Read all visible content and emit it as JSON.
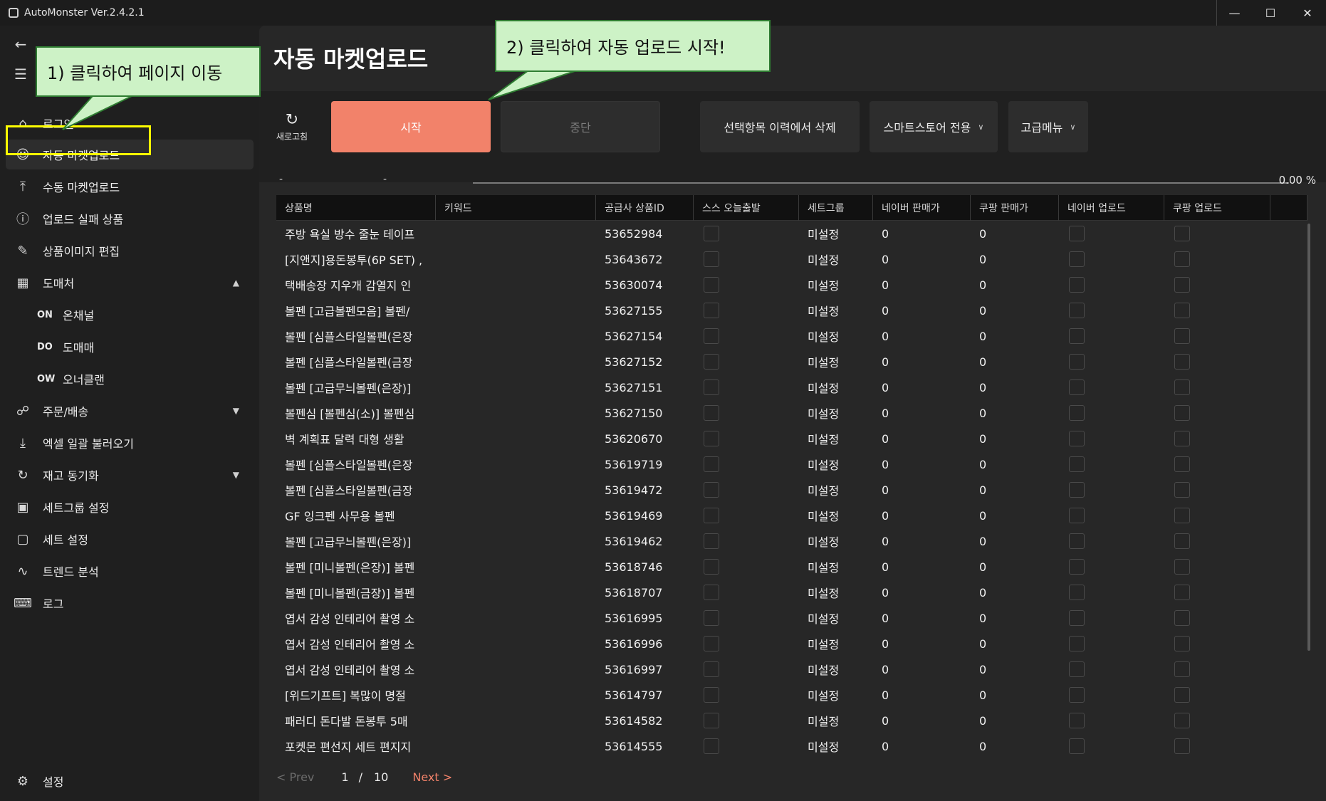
{
  "window": {
    "title": "AutoMonster Ver.2.4.2.1"
  },
  "sidebar": {
    "items": [
      {
        "label": "로그인"
      },
      {
        "label": "자동 마켓업로드"
      },
      {
        "label": "수동 마켓업로드"
      },
      {
        "label": "업로드 실패 상품"
      },
      {
        "label": "상품이미지 편집"
      },
      {
        "label": "도매처"
      },
      {
        "label": "주문/배송"
      },
      {
        "label": "엑셀 일괄 불러오기"
      },
      {
        "label": "재고 동기화"
      },
      {
        "label": "세트그룹 설정"
      },
      {
        "label": "세트 설정"
      },
      {
        "label": "트렌드 분석"
      },
      {
        "label": "로그"
      }
    ],
    "sub_items": [
      {
        "badge": "ON",
        "label": "온채널"
      },
      {
        "badge": "DO",
        "label": "도매매"
      },
      {
        "badge": "OW",
        "label": "오너클랜"
      }
    ],
    "settings_label": "설정"
  },
  "page": {
    "title": "자동 마켓업로드"
  },
  "toolbar": {
    "refresh_label": "새로고침",
    "start_label": "시작",
    "stop_label": "중단",
    "delete_label": "선택항목 이력에서 삭제",
    "smartstore_label": "스마트스토어 전용",
    "advanced_label": "고급메뉴",
    "start_color": "#f2826a"
  },
  "progress": {
    "left": "-",
    "right": "-",
    "percent_text": "0.00 %",
    "value": 0.0
  },
  "table": {
    "columns": [
      "상품명",
      "키워드",
      "공급사 상품ID",
      "스스 오늘출발",
      "세트그룹",
      "네이버 판매가",
      "쿠팡 판매가",
      "네이버 업로드",
      "쿠팡 업로드"
    ],
    "rows": [
      {
        "name": "주방 욕실 방수 줄눈 테이프",
        "keyword": "",
        "id": "53652984",
        "group": "미설정",
        "naver_price": "0",
        "coupang_price": "0"
      },
      {
        "name": "[지앤지]용돈봉투(6P SET) ,",
        "keyword": "",
        "id": "53643672",
        "group": "미설정",
        "naver_price": "0",
        "coupang_price": "0"
      },
      {
        "name": "택배송장 지우개 감열지 인",
        "keyword": "",
        "id": "53630074",
        "group": "미설정",
        "naver_price": "0",
        "coupang_price": "0"
      },
      {
        "name": "볼펜 [고급볼펜모음] 볼펜/",
        "keyword": "",
        "id": "53627155",
        "group": "미설정",
        "naver_price": "0",
        "coupang_price": "0"
      },
      {
        "name": "볼펜 [심플스타일볼펜(은장",
        "keyword": "",
        "id": "53627154",
        "group": "미설정",
        "naver_price": "0",
        "coupang_price": "0"
      },
      {
        "name": "볼펜 [심플스타일볼펜(금장",
        "keyword": "",
        "id": "53627152",
        "group": "미설정",
        "naver_price": "0",
        "coupang_price": "0"
      },
      {
        "name": "볼펜 [고급무늬볼펜(은장)]",
        "keyword": "",
        "id": "53627151",
        "group": "미설정",
        "naver_price": "0",
        "coupang_price": "0"
      },
      {
        "name": "볼펜심 [볼펜심(소)] 볼펜심",
        "keyword": "",
        "id": "53627150",
        "group": "미설정",
        "naver_price": "0",
        "coupang_price": "0"
      },
      {
        "name": "벽 계획표 달력 대형 생활",
        "keyword": "",
        "id": "53620670",
        "group": "미설정",
        "naver_price": "0",
        "coupang_price": "0"
      },
      {
        "name": "볼펜 [심플스타일볼펜(은장",
        "keyword": "",
        "id": "53619719",
        "group": "미설정",
        "naver_price": "0",
        "coupang_price": "0"
      },
      {
        "name": "볼펜 [심플스타일볼펜(금장",
        "keyword": "",
        "id": "53619472",
        "group": "미설정",
        "naver_price": "0",
        "coupang_price": "0"
      },
      {
        "name": "GF 잉크펜 사무용 볼펜",
        "keyword": "",
        "id": "53619469",
        "group": "미설정",
        "naver_price": "0",
        "coupang_price": "0"
      },
      {
        "name": "볼펜 [고급무늬볼펜(은장)]",
        "keyword": "",
        "id": "53619462",
        "group": "미설정",
        "naver_price": "0",
        "coupang_price": "0"
      },
      {
        "name": "볼펜 [미니볼펜(은장)] 볼펜",
        "keyword": "",
        "id": "53618746",
        "group": "미설정",
        "naver_price": "0",
        "coupang_price": "0"
      },
      {
        "name": "볼펜 [미니볼펜(금장)] 볼펜",
        "keyword": "",
        "id": "53618707",
        "group": "미설정",
        "naver_price": "0",
        "coupang_price": "0"
      },
      {
        "name": "엽서 감성 인테리어 촬영 소",
        "keyword": "",
        "id": "53616995",
        "group": "미설정",
        "naver_price": "0",
        "coupang_price": "0"
      },
      {
        "name": "엽서 감성 인테리어 촬영 소",
        "keyword": "",
        "id": "53616996",
        "group": "미설정",
        "naver_price": "0",
        "coupang_price": "0"
      },
      {
        "name": "엽서 감성 인테리어 촬영 소",
        "keyword": "",
        "id": "53616997",
        "group": "미설정",
        "naver_price": "0",
        "coupang_price": "0"
      },
      {
        "name": "[위드기프트] 복많이 명절",
        "keyword": "",
        "id": "53614797",
        "group": "미설정",
        "naver_price": "0",
        "coupang_price": "0"
      },
      {
        "name": "패러디 돈다발 돈봉투 5매",
        "keyword": "",
        "id": "53614582",
        "group": "미설정",
        "naver_price": "0",
        "coupang_price": "0"
      },
      {
        "name": "포켓몬 편선지 세트 편지지",
        "keyword": "",
        "id": "53614555",
        "group": "미설정",
        "naver_price": "0",
        "coupang_price": "0"
      }
    ]
  },
  "pagination": {
    "prev_label": "< Prev",
    "current": "1",
    "separator": "/",
    "total": "10",
    "next_label": "Next >"
  },
  "annotations": {
    "callout_1": "1) 클릭하여 페이지 이동",
    "callout_2": "2) 클릭하여 자동 업로드 시작!",
    "callout_color": "#cdf2c6",
    "highlight_color": "#ffff00"
  }
}
